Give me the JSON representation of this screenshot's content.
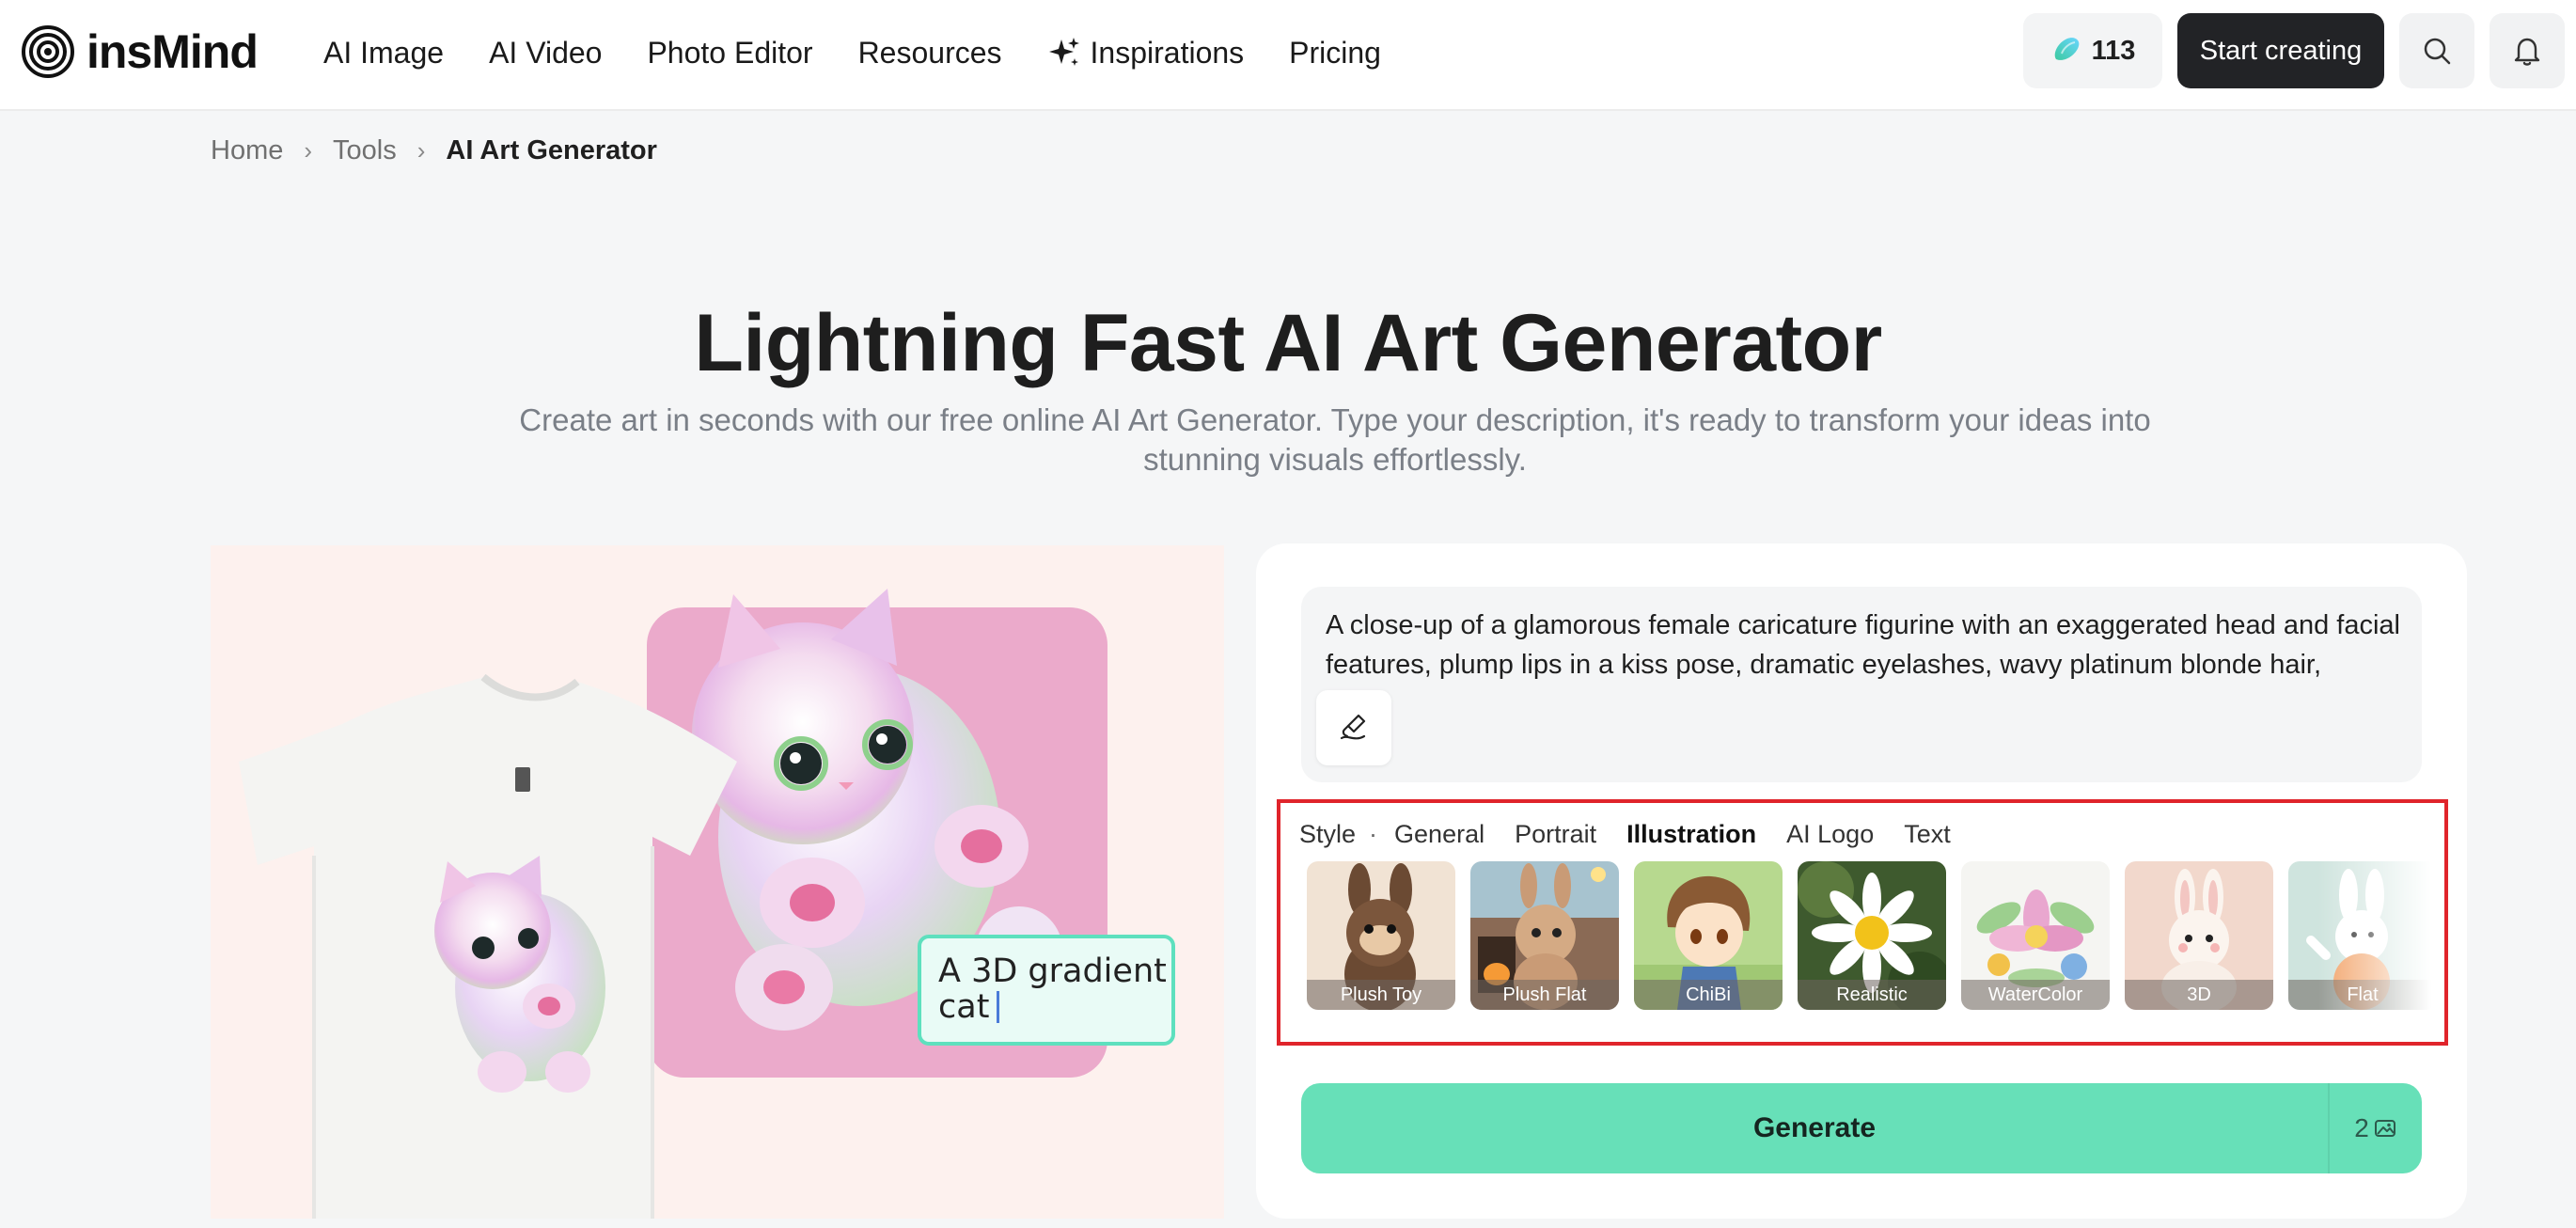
{
  "brand": {
    "name": "insMind"
  },
  "nav": {
    "items": [
      "AI Image",
      "AI Video",
      "Photo Editor",
      "Resources",
      "Inspirations",
      "Pricing"
    ]
  },
  "header": {
    "credits": "113",
    "start_label": "Start creating"
  },
  "breadcrumb": {
    "home": "Home",
    "tools": "Tools",
    "current": "AI Art Generator"
  },
  "hero": {
    "title": "Lightning Fast AI Art Generator",
    "subtitle": "Create art in seconds with our free online AI Art Generator. Type your description, it's ready to transform your ideas into stunning visuals effortlessly."
  },
  "demo": {
    "caption_line1": "A 3D gradient",
    "caption_line2": "cat"
  },
  "prompt": {
    "text": "A close-up of a glamorous female caricature figurine with an exaggerated head and facial features, plump lips in a kiss pose, dramatic eyelashes, wavy platinum blonde hair, wearing"
  },
  "style": {
    "label": "Style",
    "separator": "·",
    "tabs": [
      "General",
      "Portrait",
      "Illustration",
      "AI Logo",
      "Text"
    ],
    "active_tab": "Illustration",
    "thumbs": [
      "Plush Toy",
      "Plush Flat",
      "ChiBi",
      "Realistic",
      "WaterColor",
      "3D",
      "Flat"
    ]
  },
  "generate": {
    "label": "Generate",
    "count": "2"
  },
  "colors": {
    "accent": "#67e0b8",
    "highlight_border": "#e0242b",
    "dark_button": "#222326"
  },
  "icons": {
    "logo": "concentric-circles-icon",
    "inspirations": "sparkle-icon",
    "credits": "gem-icon",
    "search": "search-icon",
    "notifications": "bell-icon",
    "prompt_tool": "brush-hand-icon",
    "image_count": "image-icon"
  }
}
